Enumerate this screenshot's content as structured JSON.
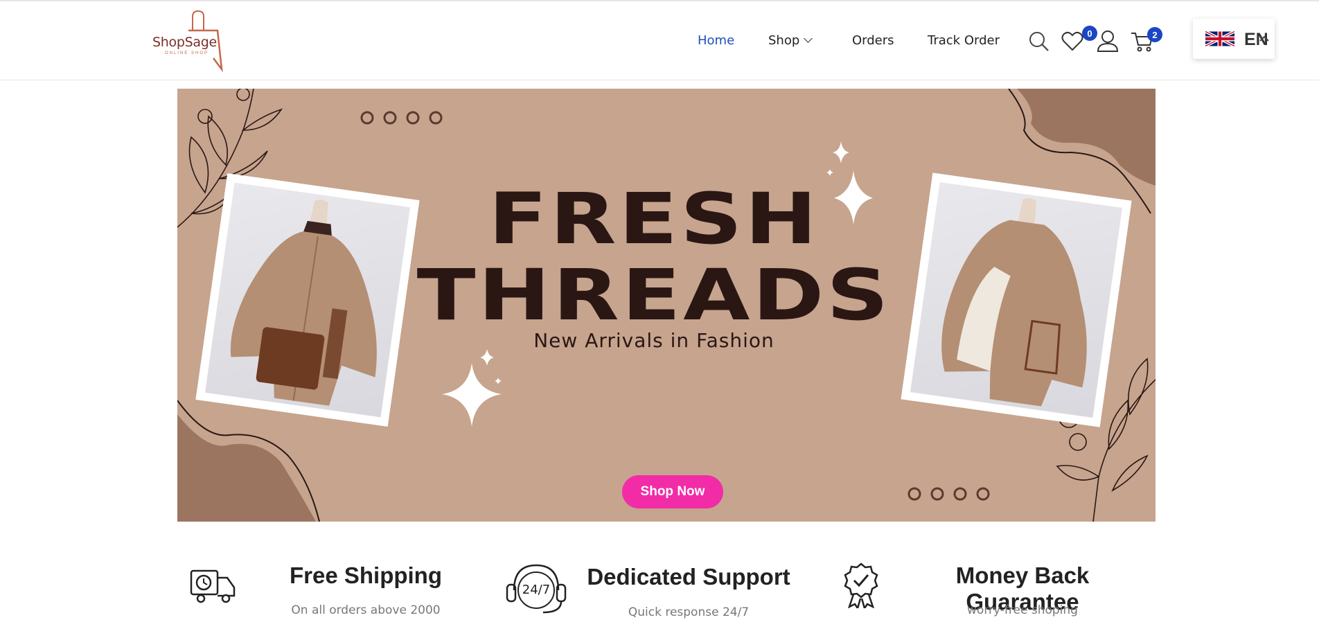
{
  "brand": {
    "name": "ShopSage",
    "subtitle": "ONLINE SHOP",
    "accent": "#c4674a"
  },
  "nav": {
    "home": "Home",
    "shop": "Shop",
    "orders": "Orders",
    "track": "Track Order",
    "active_color": "#1e4fbf"
  },
  "header_icons": {
    "search": "search-icon",
    "wishlist": "heart-icon",
    "wishlist_count": "0",
    "account": "user-icon",
    "cart": "cart-icon",
    "cart_count": "2",
    "badge_color": "#1b47c4"
  },
  "language": {
    "code": "EN",
    "flag": "uk-flag-icon"
  },
  "banner": {
    "line1": "FRESH",
    "line2": "THREADS",
    "tagline": "New Arrivals in Fashion",
    "cta": "Shop Now",
    "background": "#c6a48e",
    "cta_color": "#f22ca7",
    "text_color": "#2a1714"
  },
  "features": [
    {
      "icon": "delivery-truck-icon",
      "title": "Free Shipping",
      "subtitle": "On all orders above 2000"
    },
    {
      "icon": "support-headset-icon",
      "title": "Dedicated Support",
      "subtitle": "Quick response 24/7"
    },
    {
      "icon": "guarantee-badge-icon",
      "title": "Money Back Guarantee",
      "subtitle": "worry-free shoping"
    }
  ],
  "support_icon_text": "24/7"
}
